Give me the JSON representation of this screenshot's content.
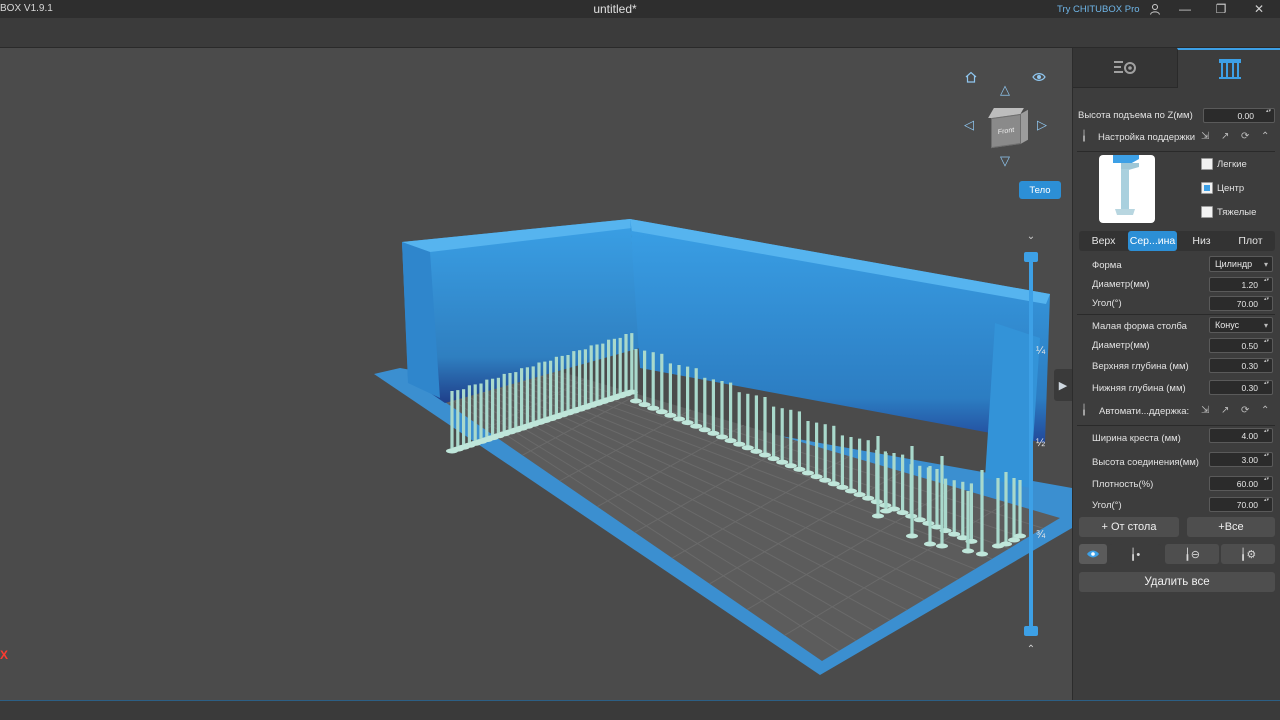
{
  "titlebar": {
    "app_name": "BOX V1.9.1",
    "doc_title": "untitled*",
    "try_pro": "Try CHITUBOX Pro"
  },
  "viewport": {
    "axis_label": "X",
    "cube_label": "Front",
    "body_button": "Тело",
    "slider_marks": [
      "¼",
      "½",
      "¾"
    ]
  },
  "panel": {
    "lift_label": "Высота подъема по Z(мм)",
    "lift_value": "0.00",
    "support_settings": "Настройка поддержки",
    "checks": [
      "Легкие",
      "Центр",
      "Тяжелые"
    ],
    "subtabs": [
      "Верх",
      "Сер...ина",
      "Низ",
      "Плот"
    ],
    "shape_label": "Форма",
    "shape_value": "Цилиндр",
    "diameter_label": "Диаметр(мм)",
    "diameter_value": "1.20",
    "angle_label": "Угол(°)",
    "angle_value": "70.00",
    "small_shape_label": "Малая форма столба",
    "small_shape_value": "Конус",
    "small_diameter_label": "Диаметр(мм)",
    "small_diameter_value": "0.50",
    "top_depth_label": "Верхняя глубина (мм)",
    "top_depth_value": "0.30",
    "bottom_depth_label": "Нижняя глубина (мм)",
    "bottom_depth_value": "0.30",
    "auto_support": "Автомати...ддержка:",
    "cross_width_label": "Ширина креста (мм)",
    "cross_width_value": "4.00",
    "joint_height_label": "Высота соединения(мм)",
    "joint_height_value": "3.00",
    "density_label": "Плотность(%)",
    "density_value": "60.00",
    "auto_angle_label": "Угол(°)",
    "auto_angle_value": "70.00",
    "from_table": "+ От стола",
    "all_button": "+Все",
    "delete_all": "Удалить все"
  },
  "colors": {
    "accent": "#2c8fd6",
    "model": "#3aa0e6",
    "supports": "#a9d9cc",
    "plate_grid": "#5a5a5a"
  }
}
